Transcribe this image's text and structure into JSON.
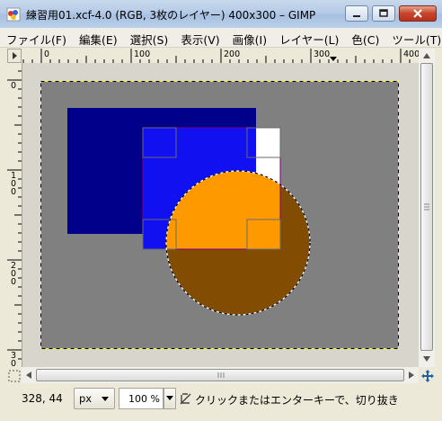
{
  "window": {
    "title": "練習用01.xcf-4.0 (RGB, 3枚のレイヤー) 400x300 – GIMP",
    "minimize_icon": "minimize-icon",
    "maximize_icon": "maximize-icon",
    "close_icon": "close-icon"
  },
  "menubar": {
    "items": [
      "ファイル(F)",
      "編集(E)",
      "選択(S)",
      "表示(V)",
      "画像(I)",
      "レイヤー(L)",
      "色(C)",
      "ツール(T)"
    ]
  },
  "rulers": {
    "horizontal_labels": [
      "0",
      "100",
      "200",
      "300",
      "400"
    ],
    "vertical_labels": [
      [
        "0"
      ],
      [
        "1",
        "0",
        "0"
      ],
      [
        "2",
        "0",
        "0"
      ],
      [
        "3",
        "0"
      ]
    ]
  },
  "statusbar": {
    "coords": "328, 44",
    "unit": "px",
    "zoom": "100 %",
    "message": "クリックまたはエンターキーで、切り抜き"
  },
  "colors": {
    "gray_layer": "#808080",
    "navy_rect": "#00008b",
    "blue_rect": "#1010f0",
    "orange_circle": "#ff9900",
    "dark_orange": "#824d02"
  }
}
